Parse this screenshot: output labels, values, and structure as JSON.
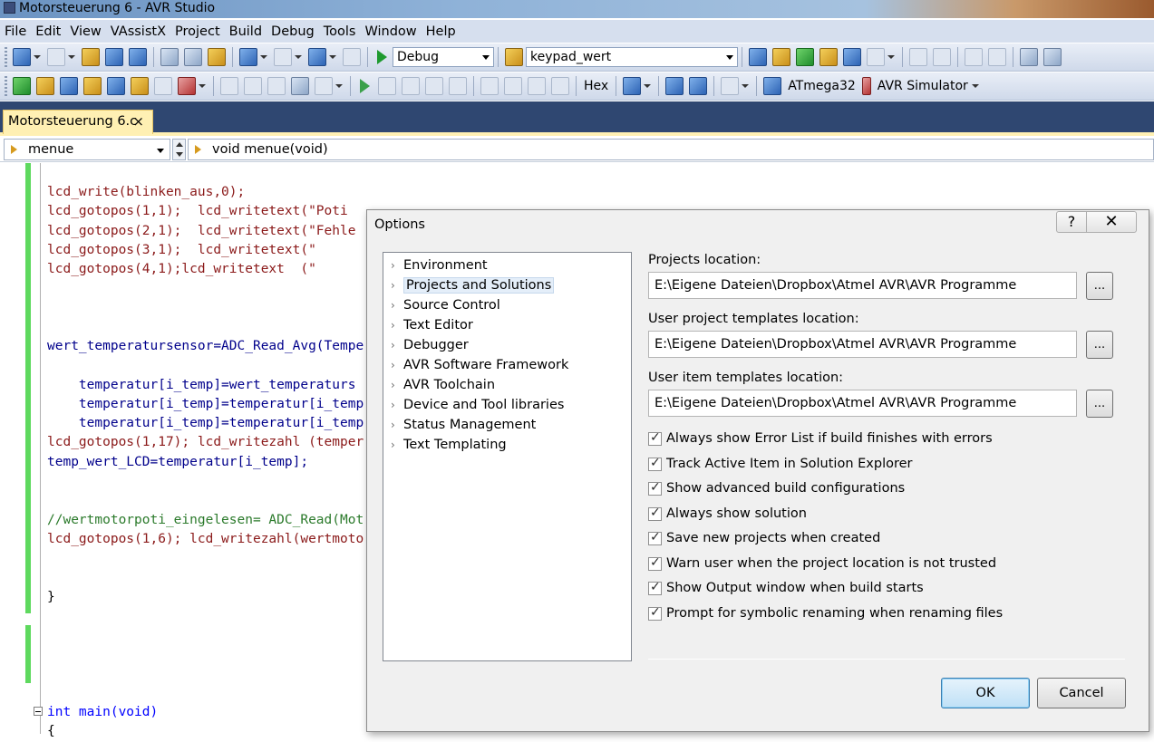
{
  "window": {
    "title": "Motorsteuerung 6 - AVR Studio"
  },
  "menu": [
    "File",
    "Edit",
    "View",
    "VAssistX",
    "Project",
    "Build",
    "Debug",
    "Tools",
    "Window",
    "Help"
  ],
  "toolbar1": {
    "config": "Debug",
    "find": "keypad_wert"
  },
  "toolbar2": {
    "hex_label": "Hex",
    "device": "ATmega32",
    "tool": "AVR Simulator"
  },
  "tab": {
    "label": "Motorsteuerung 6.c",
    "close": "×"
  },
  "nav": {
    "scope": "menue",
    "member": "void menue(void)"
  },
  "code": {
    "lines": [
      "lcd_write(blinken_aus,0);",
      "lcd_gotopos(1,1);  lcd_writetext(\"Poti",
      "lcd_gotopos(2,1);  lcd_writetext(\"Fehle",
      "lcd_gotopos(3,1);  lcd_writetext(\"",
      "lcd_gotopos(4,1);lcd_writetext  (\"",
      "wert_temperatursensor=ADC_Read_Avg(Tempe",
      "    temperatur[i_temp]=wert_temperaturs",
      "    temperatur[i_temp]=temperatur[i_temp",
      "    temperatur[i_temp]=temperatur[i_temp",
      "lcd_gotopos(1,17); lcd_writezahl (temper",
      "temp_wert_LCD=temperatur[i_temp];",
      "//wertmotorpoti_eingelesen= ADC_Read(Mot",
      "lcd_gotopos(1,6); lcd_writezahl(wertmoto",
      "}",
      "int main(void)",
      "{"
    ]
  },
  "dialog": {
    "title": "Options",
    "help": "?",
    "close": "✕",
    "tree": [
      "Environment",
      "Projects and Solutions",
      "Source Control",
      "Text Editor",
      "Debugger",
      "AVR Software Framework",
      "AVR Toolchain",
      "Device and Tool libraries",
      "Status Management",
      "Text Templating"
    ],
    "projects_location": {
      "label": "Projects location:",
      "value": "E:\\Eigene Dateien\\Dropbox\\Atmel AVR\\AVR Programme"
    },
    "project_templates": {
      "label": "User project templates location:",
      "value": "E:\\Eigene Dateien\\Dropbox\\Atmel AVR\\AVR Programme"
    },
    "item_templates": {
      "label": "User item templates location:",
      "value": "E:\\Eigene Dateien\\Dropbox\\Atmel AVR\\AVR Programme"
    },
    "browse": "...",
    "checkboxes": [
      "Always show Error List if build finishes with errors",
      "Track Active Item in Solution Explorer",
      "Show advanced build configurations",
      "Always show solution",
      "Save new projects when created",
      "Warn user when the project location is not trusted",
      "Show Output window when build starts",
      "Prompt for symbolic renaming when renaming files"
    ],
    "ok": "OK",
    "cancel": "Cancel"
  }
}
